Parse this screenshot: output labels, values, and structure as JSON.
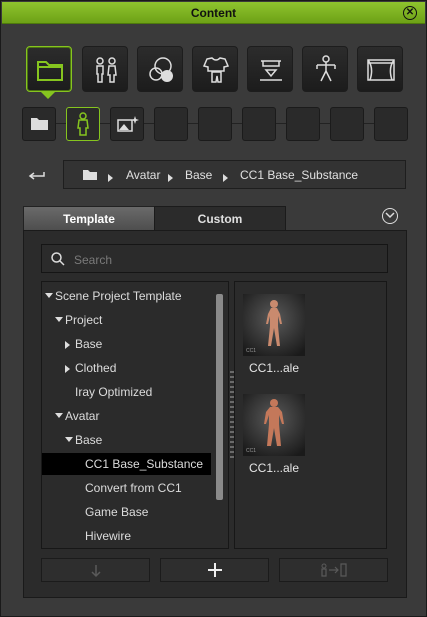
{
  "window": {
    "title": "Content"
  },
  "main_toolbar": {
    "buttons": [
      {
        "name": "folder",
        "icon": "folder-icon",
        "selected": true
      },
      {
        "name": "character",
        "icon": "character-pair-icon",
        "selected": false
      },
      {
        "name": "material",
        "icon": "material-spheres-icon",
        "selected": false
      },
      {
        "name": "cloth",
        "icon": "cloth-icon",
        "selected": false
      },
      {
        "name": "accessory",
        "icon": "hat-accessory-icon",
        "selected": false
      },
      {
        "name": "motion",
        "icon": "motion-pose-icon",
        "selected": false
      },
      {
        "name": "scene",
        "icon": "stage-scene-icon",
        "selected": false
      }
    ]
  },
  "sub_toolbar": {
    "buttons": [
      {
        "icon": "folder-icon"
      },
      {
        "icon": "avatar-icon",
        "selected": true
      },
      {
        "icon": "image-sparkle-icon"
      },
      {
        "icon": ""
      },
      {
        "icon": ""
      },
      {
        "icon": ""
      },
      {
        "icon": ""
      },
      {
        "icon": ""
      },
      {
        "icon": ""
      }
    ]
  },
  "breadcrumb": {
    "back_icon": "back-arrow-icon",
    "items": [
      "Avatar",
      "Base",
      "CC1 Base_Substance"
    ]
  },
  "tabs": {
    "template": "Template",
    "custom": "Custom"
  },
  "search": {
    "placeholder": "Search"
  },
  "tree": [
    {
      "label": "Scene Project Template",
      "level": 0,
      "expander": "down"
    },
    {
      "label": "Project",
      "level": 1,
      "expander": "down"
    },
    {
      "label": "Base",
      "level": 2,
      "expander": "right"
    },
    {
      "label": "Clothed",
      "level": 2,
      "expander": "right"
    },
    {
      "label": "Iray Optimized",
      "level": 2,
      "expander": ""
    },
    {
      "label": "Avatar",
      "level": 1,
      "expander": "down"
    },
    {
      "label": "Base",
      "level": 2,
      "expander": "down"
    },
    {
      "label": "CC1 Base_Substance",
      "level": 3,
      "expander": "",
      "selected": true
    },
    {
      "label": "Convert from CC1",
      "level": 3,
      "expander": ""
    },
    {
      "label": "Game Base",
      "level": 3,
      "expander": ""
    },
    {
      "label": "Hivewire",
      "level": 3,
      "expander": ""
    }
  ],
  "thumbnails": [
    {
      "caption": "CC1...ale",
      "badge": "CC1"
    },
    {
      "caption": "CC1...ale",
      "badge": "CC1"
    }
  ],
  "bottom_buttons": [
    {
      "icon": "download-arrow-icon",
      "enabled": false
    },
    {
      "icon": "plus-icon",
      "enabled": true
    },
    {
      "icon": "apply-figure-icon",
      "enabled": false
    }
  ],
  "colors": {
    "accent": "#86c51f",
    "title_bar": "#7cb522",
    "selection": "#000000"
  }
}
